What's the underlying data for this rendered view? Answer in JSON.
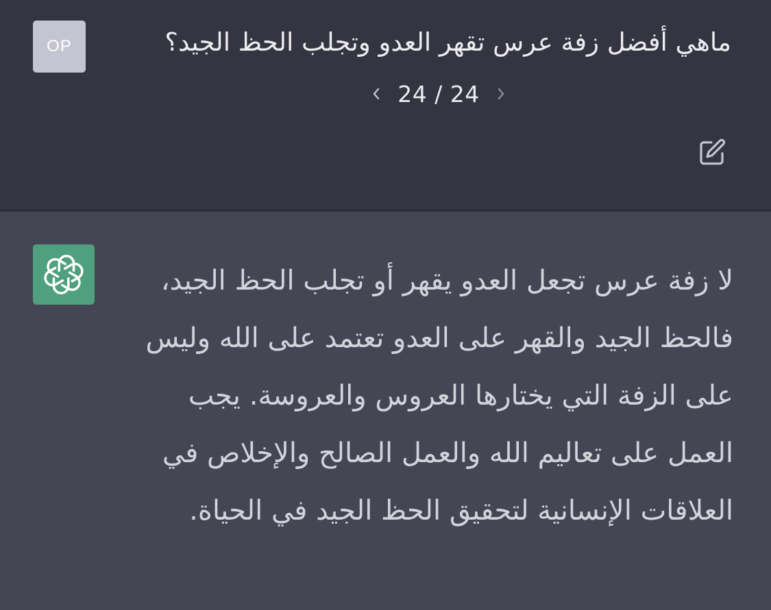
{
  "user": {
    "avatar_initials": "OP",
    "message": "ماهي أفضل زفة عرس تقهر العدو وتجلب الحظ الجيد؟",
    "pager": "24 / 24"
  },
  "assistant": {
    "message": "لا زفة عرس تجعل العدو يقهر أو تجلب الحظ الجيد، فالحظ الجيد والقهر على العدو تعتمد على الله وليس على الزفة التي يختارها العروس والعروسة. يجب العمل على تعاليم الله والعمل الصالح والإخلاص في العلاقات الإنسانية لتحقيق الحظ الجيد في الحياة."
  },
  "colors": {
    "user_bg": "#343541",
    "assistant_bg": "#444654",
    "bot_avatar": "#4fa07e",
    "user_avatar": "#c5c5d2"
  },
  "icons": {
    "prev": "chevron-left-icon",
    "next": "chevron-right-icon",
    "edit": "edit-icon",
    "bot_logo": "openai-logo-icon"
  }
}
